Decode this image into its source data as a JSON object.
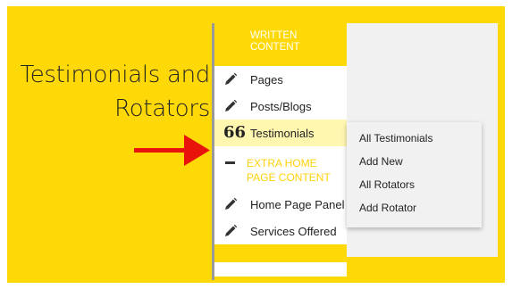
{
  "headline": {
    "line1": "Testimonials and",
    "line2": "Rotators"
  },
  "menu": {
    "header": "WRITTEN CONTENT",
    "items": [
      {
        "label": "Pages",
        "icon": "pencil-icon"
      },
      {
        "label": "Posts/Blogs",
        "icon": "pencil-icon"
      },
      {
        "label": "Testimonials",
        "icon": "quote-icon",
        "glyph": "66",
        "active": true
      },
      {
        "label": "EXTRA HOME PAGE CONTENT",
        "icon": "minus-icon",
        "section": true
      },
      {
        "label": "Home Page Panel",
        "icon": "pencil-icon"
      },
      {
        "label": "Services Offered",
        "icon": "pencil-icon"
      }
    ]
  },
  "submenu": {
    "items": [
      "All Testimonials",
      "Add New",
      "All Rotators",
      "Add Rotator"
    ]
  },
  "colors": {
    "background": "#ffd907",
    "arrow": "#e8140b",
    "section_label": "#ffd10a",
    "active_item": "#fff7b0"
  }
}
